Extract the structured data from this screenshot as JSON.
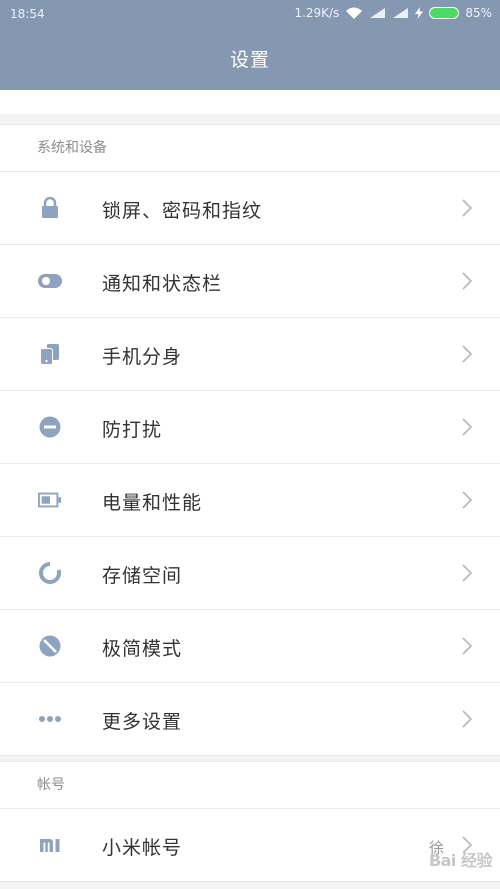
{
  "status_bar": {
    "time": "18:54",
    "speed": "1.29K/s",
    "battery": "85%"
  },
  "header": {
    "title": "设置"
  },
  "sections": [
    {
      "label": "系统和设备",
      "items": [
        {
          "label": "锁屏、密码和指纹",
          "icon": "lock-icon"
        },
        {
          "label": "通知和状态栏",
          "icon": "toggle-icon"
        },
        {
          "label": "手机分身",
          "icon": "dual-phone-icon"
        },
        {
          "label": "防打扰",
          "icon": "do-not-disturb-icon"
        },
        {
          "label": "电量和性能",
          "icon": "battery-icon"
        },
        {
          "label": "存储空间",
          "icon": "storage-pie-icon"
        },
        {
          "label": "极简模式",
          "icon": "simple-mode-icon"
        },
        {
          "label": "更多设置",
          "icon": "more-dots-icon"
        }
      ]
    },
    {
      "label": "帐号",
      "items": [
        {
          "label": "小米帐号",
          "icon": "mi-logo-icon",
          "value": "徐"
        }
      ]
    }
  ],
  "watermark": "Bai 经验",
  "colors": {
    "header": "#8598b1",
    "icon": "#8ea3bf",
    "text": "#333333",
    "sub": "#8d8d8d"
  }
}
